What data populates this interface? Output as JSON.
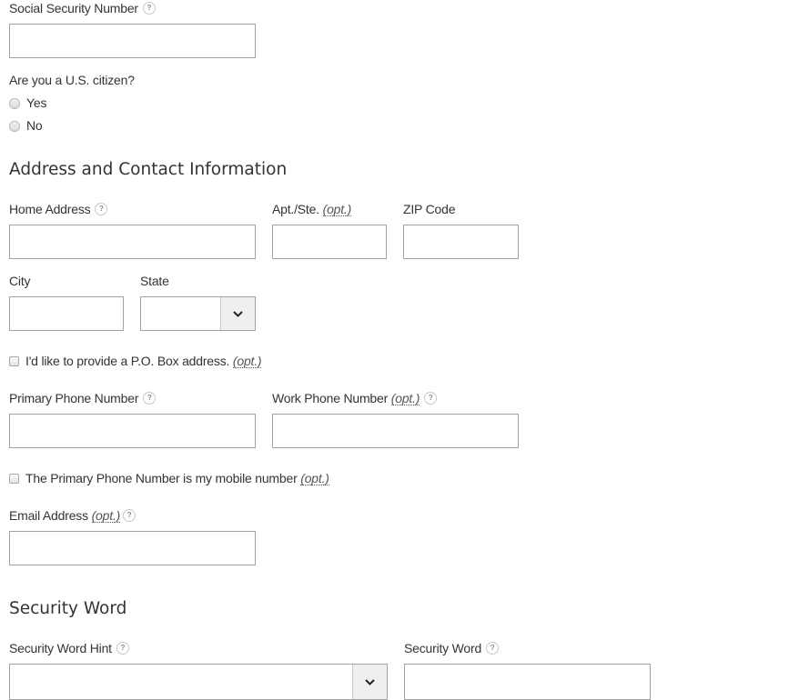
{
  "ssn": {
    "label": "Social Security Number",
    "help": "?",
    "value": ""
  },
  "citizen": {
    "question": "Are you a U.S. citizen?",
    "options": [
      {
        "label": "Yes",
        "checked": false
      },
      {
        "label": "No",
        "checked": false
      }
    ]
  },
  "address_section": {
    "heading": "Address and Contact Information",
    "home_address": {
      "label": "Home Address",
      "help": "?",
      "value": ""
    },
    "apt": {
      "label": "Apt./Ste.",
      "opt": "(opt.)",
      "value": ""
    },
    "zip": {
      "label": "ZIP Code",
      "value": ""
    },
    "city": {
      "label": "City",
      "value": ""
    },
    "state": {
      "label": "State",
      "selected": ""
    },
    "po_box": {
      "label": "I'd like to provide a P.O. Box address.",
      "opt": "(opt.)",
      "checked": false
    },
    "primary_phone": {
      "label": "Primary Phone Number",
      "help": "?",
      "value": ""
    },
    "work_phone": {
      "label": "Work Phone Number",
      "opt": "(opt.)",
      "help": "?",
      "value": ""
    },
    "mobile": {
      "label": "The Primary Phone Number is my mobile number",
      "opt": "(opt.)",
      "checked": false
    },
    "email": {
      "label": "Email Address",
      "opt": "(opt.)",
      "help": "?",
      "value": ""
    }
  },
  "security_section": {
    "heading": "Security Word",
    "hint": {
      "label": "Security Word Hint",
      "help": "?",
      "selected": ""
    },
    "word": {
      "label": "Security Word",
      "help": "?",
      "value": ""
    }
  },
  "icons": {
    "help": "question-circle",
    "dropdown": "chevron-down"
  }
}
